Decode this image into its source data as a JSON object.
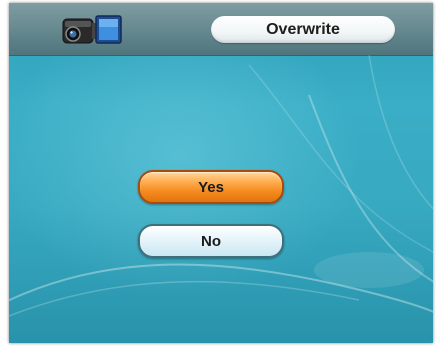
{
  "header": {
    "icon": "video-camera-icon",
    "title": "Overwrite"
  },
  "dialog": {
    "yes_label": "Yes",
    "no_label": "No",
    "selected": "Yes"
  },
  "colors": {
    "header_bg": "#6a8b92",
    "screen_bg": "#37a9c1",
    "selected_button": "#f58a1f",
    "unselected_button": "#e9f6fb"
  }
}
